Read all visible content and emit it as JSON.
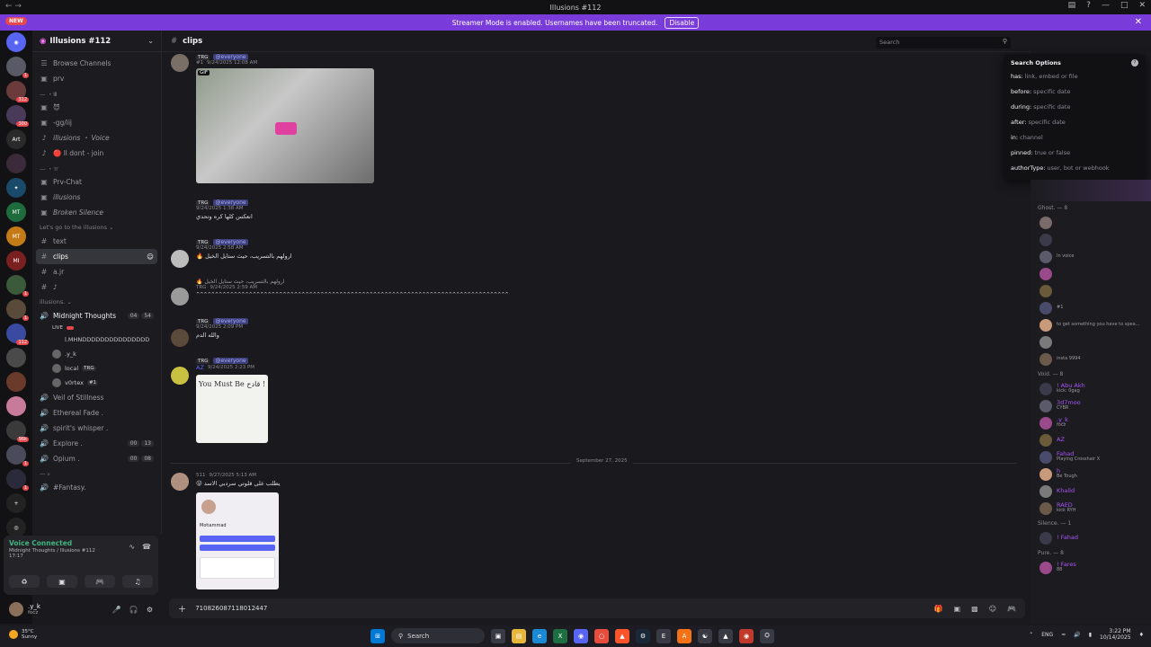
{
  "window": {
    "title": "Illusions #112",
    "controls": [
      "—",
      "□",
      "✕"
    ]
  },
  "banner": {
    "new_badge": "NEW",
    "message": "Streamer Mode is enabled. Usernames have been truncated.",
    "button": "Disable"
  },
  "guild_badges": [
    "1",
    "312",
    "300",
    "1",
    "1",
    "112",
    "96k",
    "1",
    "1"
  ],
  "server": {
    "name": "Illusions #112"
  },
  "channels": {
    "browse": "Browse Channels",
    "items": [
      {
        "kind": "text-locked",
        "label": "prv"
      },
      {
        "kind": "cat",
        "label": "— ・Ⅲ"
      },
      {
        "kind": "text-locked",
        "label": "😈"
      },
      {
        "kind": "text-locked",
        "label": "-gg/iij"
      },
      {
        "kind": "voice-locked",
        "label": "illusions ・ Voice",
        "italic": true
      },
      {
        "kind": "voice-locked",
        "label": "🔴 ll dont - join"
      },
      {
        "kind": "cat",
        "label": "— ・ㅠ"
      },
      {
        "kind": "text-locked",
        "label": "Prv-Chat"
      },
      {
        "kind": "text-locked",
        "label": "illusions",
        "italic": true
      },
      {
        "kind": "text-locked",
        "label": "Broken Silence",
        "italic": true
      },
      {
        "kind": "cat",
        "label": "Let's go to the illusions ⌄"
      },
      {
        "kind": "text",
        "label": "text"
      },
      {
        "kind": "text",
        "label": "clips",
        "active": true
      },
      {
        "kind": "text",
        "label": "a.jr"
      },
      {
        "kind": "text",
        "label": "♪"
      },
      {
        "kind": "cat",
        "label": "illusions. ⌄"
      }
    ],
    "voice_channel": {
      "label": "Midnight Thoughts",
      "live": "LIVE",
      "count_a": "04",
      "count_b": "54",
      "status": "l.MHNDDDDDDDDDDDDDDD"
    },
    "voice_users": [
      {
        "name": ".y_k",
        "tag": ""
      },
      {
        "name": "local",
        "tag": "TRG"
      },
      {
        "name": "v0rtex",
        "tag": "#1"
      }
    ],
    "more": [
      {
        "label": "Veil of Stillness"
      },
      {
        "label": "Ethereal Fade ."
      },
      {
        "label": "spirit's whisper ."
      },
      {
        "label": "Explore .",
        "a": "00",
        "b": "13"
      },
      {
        "label": "Opium .",
        "a": "00",
        "b": "08"
      },
      {
        "label": "— ℴ",
        "cat": true
      },
      {
        "label": "#Fantasy."
      }
    ]
  },
  "voice_panel": {
    "title": "Voice Connected",
    "sub": "Midnight Thoughts / Illusions #112",
    "time": "17:17"
  },
  "user": {
    "name": ".y_k",
    "status": "focz"
  },
  "header": {
    "channel": "clips",
    "search_placeholder": "Search"
  },
  "messages": [
    {
      "reply_tag": "TRG",
      "mention": "@everyone",
      "time": "9/24/2025 12:08 AM",
      "badge": "#1",
      "gif": "GIF"
    },
    {
      "reply_tag": "TRG",
      "mention": "@everyone",
      "time": "9/24/2025 1:38 AM",
      "text": "انعكس كلها كره وتحدي"
    },
    {
      "reply_tag": "TRG",
      "mention": "@everyone",
      "time": "9/24/2025 2:58 AM",
      "text": "🔥 ارولهم بالتسريب، حيث ستايل الخيل"
    },
    {
      "reply_text": "🔥 ارولهم بالتسريب، حيث ستايل الخيل",
      "tag": "TRG",
      "time": "9/24/2025 2:59 AM",
      "text": "^^^^^^^^^^^^^^^^^^^^^^^^^^^^^^^^^^^^^^^^^^^^^^^^^^^^^^^^^^^^^^^^^^^^^^^^^^^^^^^^^^^"
    },
    {
      "reply_tag": "TRG",
      "mention": "@everyone",
      "time": "9/24/2025 2:09 PM",
      "text": "والله الدم"
    },
    {
      "reply_tag": "TRG",
      "mention": "@everyone",
      "name": "AZ",
      "time": "9/24/2025 2:23 PM",
      "image_text": "You Must Be قادح !"
    },
    {
      "date": "September 27, 2025"
    },
    {
      "tag": "511",
      "time": "9/27/2025 5:13 AM",
      "text": "😜 يطلب على قلوتي سردبي الاسد",
      "card_name": "Mohammad"
    }
  ],
  "composer": {
    "value": "710826087118012447"
  },
  "search_options": {
    "title": "Search Options",
    "rows": [
      {
        "key": "has:",
        "hint": "link, embed or file"
      },
      {
        "key": "before:",
        "hint": "specific date"
      },
      {
        "key": "during:",
        "hint": "specific date"
      },
      {
        "key": "after:",
        "hint": "specific date"
      },
      {
        "key": "in:",
        "hint": "channel"
      },
      {
        "key": "pinned:",
        "hint": "true or false"
      },
      {
        "key": "authorType:",
        "hint": "user, bot or webhook"
      }
    ]
  },
  "members": [
    {
      "cat": "Ghost. — 8"
    },
    {
      "name": "",
      "status": ""
    },
    {
      "name": "",
      "status": ""
    },
    {
      "name": "",
      "status": "In voice"
    },
    {
      "name": "",
      "status": ""
    },
    {
      "name": "",
      "status": ""
    },
    {
      "name": "",
      "status": "#1"
    },
    {
      "name": "",
      "status": "to get something you have to spea..."
    },
    {
      "name": "",
      "status": ""
    },
    {
      "name": "",
      "status": "insta 9994"
    },
    {
      "cat": "Void. — 8"
    },
    {
      "name": "! Abu Akh",
      "status": "kick: 0gag"
    },
    {
      "name": "3d7moo",
      "status": "CYBR"
    },
    {
      "name": ".y_k",
      "status": "focz"
    },
    {
      "name": "AZ",
      "status": ""
    },
    {
      "name": "Fahad",
      "status": "Playing Crosshair X"
    },
    {
      "name": "h",
      "status": "Be Tough"
    },
    {
      "name": "Khalid",
      "status": ""
    },
    {
      "name": "RAED",
      "status": "kick RYH"
    },
    {
      "cat": "Silence. — 1"
    },
    {
      "name": "! Fahad",
      "status": ""
    },
    {
      "cat": "Pure. — 8"
    },
    {
      "name": "! Fares",
      "status": "88"
    }
  ],
  "taskbar": {
    "temp": "35°C",
    "cond": "Sunny",
    "search": "Search",
    "lang": "ENG",
    "time": "3:22 PM",
    "date": "10/14/2025"
  }
}
